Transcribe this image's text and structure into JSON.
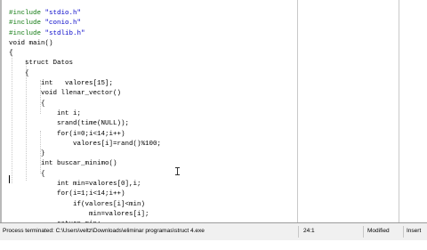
{
  "editor": {
    "lines": [
      {
        "type": "pp",
        "directive": "#include ",
        "header": "\"stdio.h\""
      },
      {
        "type": "pp",
        "directive": "#include ",
        "header": "\"conio.h\""
      },
      {
        "type": "pp",
        "directive": "#include ",
        "header": "\"stdlib.h\""
      },
      {
        "type": "code",
        "text": "void main()"
      },
      {
        "type": "code",
        "text": "{"
      },
      {
        "type": "code",
        "text": "    struct Datos"
      },
      {
        "type": "code",
        "text": "    {"
      },
      {
        "type": "code",
        "text": "        int   valores[15];"
      },
      {
        "type": "code",
        "text": "        void llenar_vector()"
      },
      {
        "type": "code",
        "text": "        {"
      },
      {
        "type": "code",
        "text": "            int i;"
      },
      {
        "type": "code",
        "text": "            srand(time(NULL));"
      },
      {
        "type": "code",
        "text": "            for(i=0;i<14;i++)"
      },
      {
        "type": "code",
        "text": "                valores[i]=rand()%100;"
      },
      {
        "type": "code",
        "text": "        }"
      },
      {
        "type": "code",
        "text": "        int buscar_minimo()"
      },
      {
        "type": "code",
        "text": "        {"
      },
      {
        "type": "code",
        "text": "            int min=valores[0],i;"
      },
      {
        "type": "code",
        "text": "            for(i=1;i<14;i++)"
      },
      {
        "type": "code",
        "text": "                if(valores[i]<min)"
      },
      {
        "type": "code",
        "text": "                    min=valores[i];"
      },
      {
        "type": "code",
        "text": "            return min;"
      },
      {
        "type": "code",
        "text": "        }"
      },
      {
        "type": "code",
        "text": ""
      }
    ]
  },
  "status": {
    "process_message": "Process terminated: C:\\Users\\veltz\\Downloads\\eliminar programas\\struct 4.exe",
    "cursor_position": "24:1",
    "modified": "Modified",
    "insert_mode": "Insert"
  },
  "colors": {
    "preprocessor": "#117a11",
    "include_string": "#0000c8",
    "code": "#000000",
    "statusbar_bg": "#f0f0f0"
  }
}
